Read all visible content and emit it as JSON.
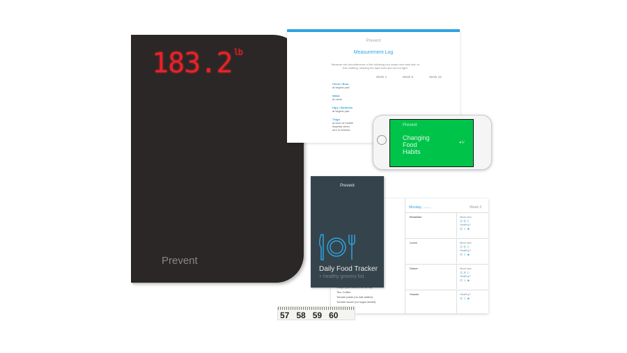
{
  "scale": {
    "reading": "183.2",
    "unit": "lb",
    "brand": "Prevent",
    "display_color": "#e8222a"
  },
  "measurement_log": {
    "brand": "Prevent",
    "title": "Measurement Log",
    "intro": "Measure the circumference of the following four areas over bare skin or thin clothing, keeping the tape level and not too tight.",
    "weeks": [
      "Week 1",
      "Week 8",
      "Week 16"
    ],
    "areas": [
      {
        "name": "Chest / Bust",
        "note": "at largest part"
      },
      {
        "name": "Waist",
        "note": "at navel"
      },
      {
        "name": "Hips / Buttocks",
        "note": "at largest part"
      },
      {
        "name": "Thigh",
        "note": "at level of middle fingertip when arm is relaxed"
      }
    ]
  },
  "phone": {
    "brand": "Prevent",
    "headline": "Changing\nFood\nHabits",
    "screen_color": "#00c44a"
  },
  "food_tracker": {
    "brand": "Prevent",
    "title": "Daily Food Tracker",
    "subtitle": "+ healthy grocery list",
    "icon": "plate-cutlery-icon"
  },
  "grocery_list": [
    "Soups (low sodium & low fat)",
    "Tea, Coffee",
    "Tomato paste (no salt added)",
    "Tomato sauce (no sugar added)"
  ],
  "tracker_page": {
    "day": "Monday, ........",
    "week": "Week 3",
    "meals": [
      {
        "name": "Breakfast",
        "size": "Meal size",
        "healthy": "Healthy?"
      },
      {
        "name": "Lunch",
        "size": "Meal size",
        "healthy": "Healthy?"
      },
      {
        "name": "Dinner",
        "size": "Meal size",
        "healthy": "Healthy?"
      },
      {
        "name": "Snacks",
        "size": "",
        "healthy": "Healthy?"
      }
    ],
    "size_marks": "ⓈⓂⓁ",
    "face_marks": "☹☺☻"
  },
  "tape": [
    "57",
    "58",
    "59",
    "60"
  ]
}
